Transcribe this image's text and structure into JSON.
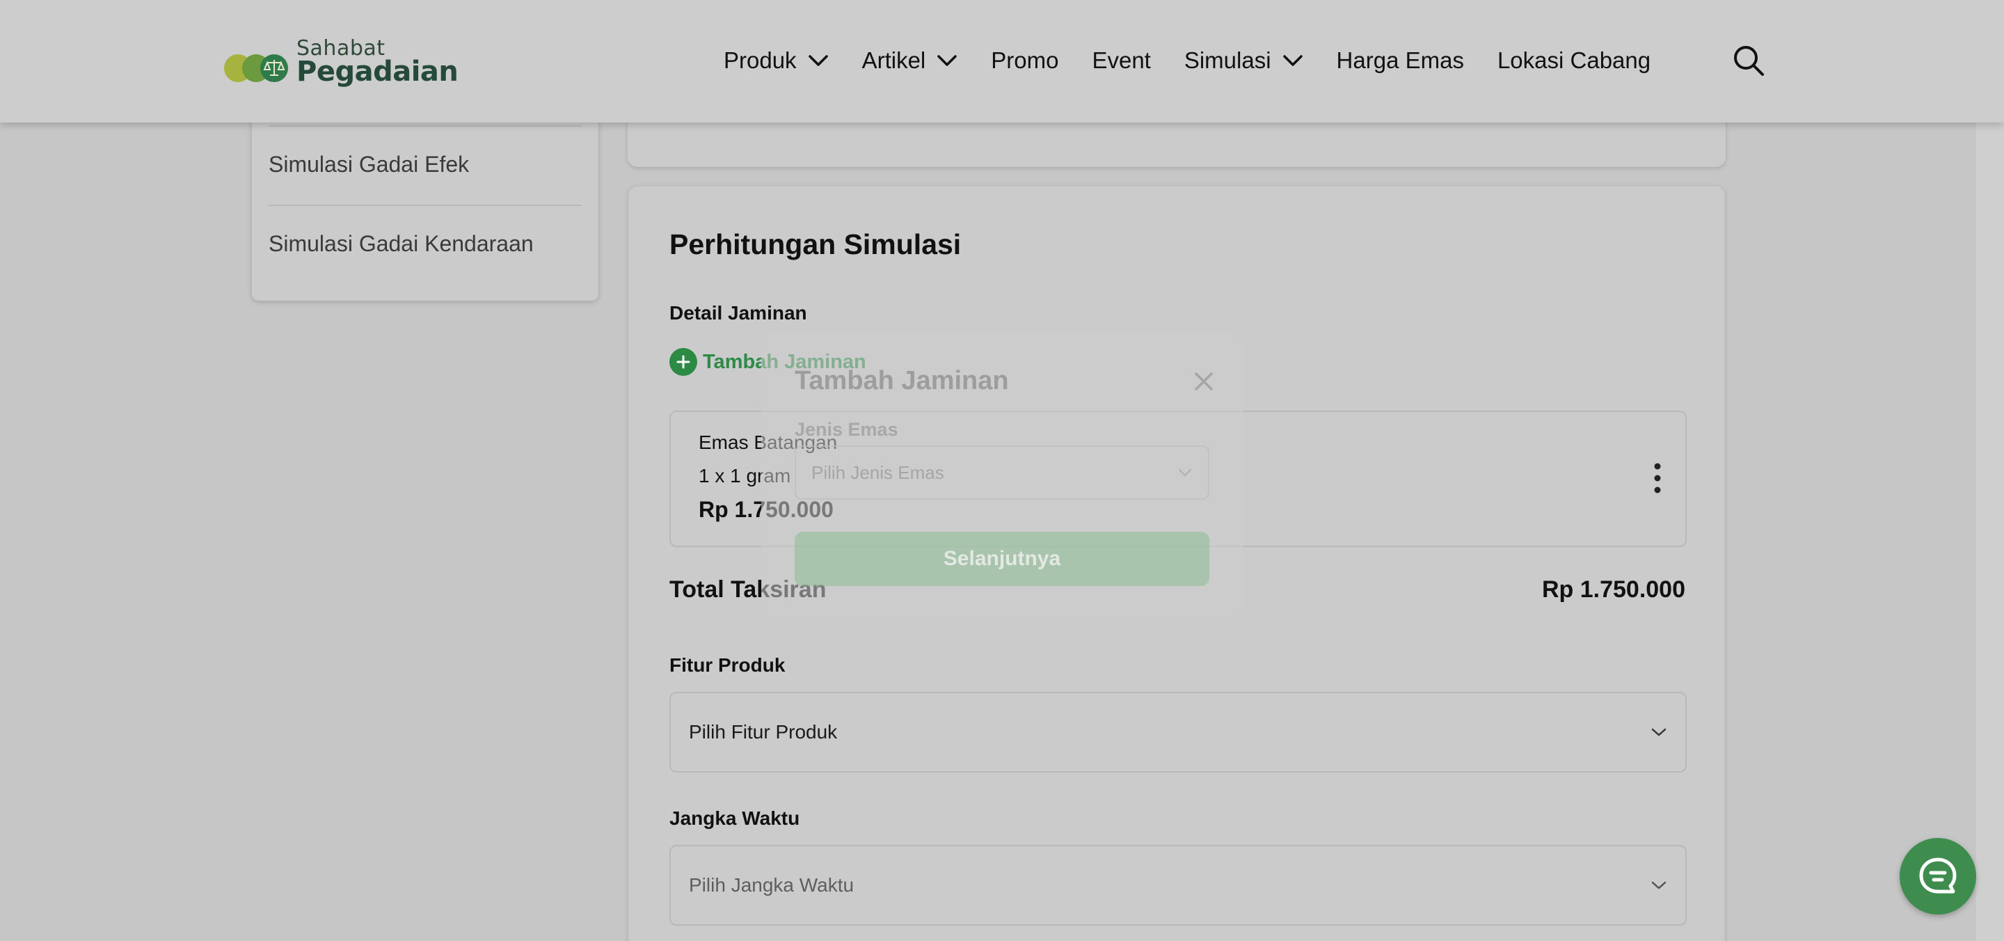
{
  "header": {
    "logo": {
      "line1": "Sahabat",
      "line2": "Pegadaian"
    },
    "nav": [
      {
        "label": "Produk",
        "dropdown": true
      },
      {
        "label": "Artikel",
        "dropdown": true
      },
      {
        "label": "Promo",
        "dropdown": false
      },
      {
        "label": "Event",
        "dropdown": false
      },
      {
        "label": "Simulasi",
        "dropdown": true
      },
      {
        "label": "Harga Emas",
        "dropdown": false
      },
      {
        "label": "Lokasi Cabang",
        "dropdown": false
      }
    ],
    "search_icon": "search-icon"
  },
  "sidebar": {
    "items": [
      {
        "label": "Simulasi Gadai Efek"
      },
      {
        "label": "Simulasi Gadai Kendaraan"
      }
    ]
  },
  "main": {
    "title": "Perhitungan Simulasi",
    "detail_label": "Detail Jaminan",
    "add_label": "Tambah Jaminan",
    "item": {
      "name": "Emas Batangan",
      "qty": "1 x 1 gram",
      "price": "Rp 1.750.000"
    },
    "total_label": "Total Taksiran",
    "total_value": "Rp 1.750.000",
    "fitur_label": "Fitur Produk",
    "fitur_value": "Pilih Fitur Produk",
    "jangka_label": "Jangka Waktu",
    "jangka_placeholder": "Pilih Jangka Waktu"
  },
  "modal": {
    "title": "Tambah Jaminan",
    "field_label": "Jenis Emas",
    "select_placeholder": "Pilih Jenis Emas",
    "button_label": "Selanjutnya"
  },
  "colors": {
    "brand_green": "#2e8a47",
    "chat_fab": "#3e8d4f",
    "overlay_bg": "#c6c6c6"
  }
}
